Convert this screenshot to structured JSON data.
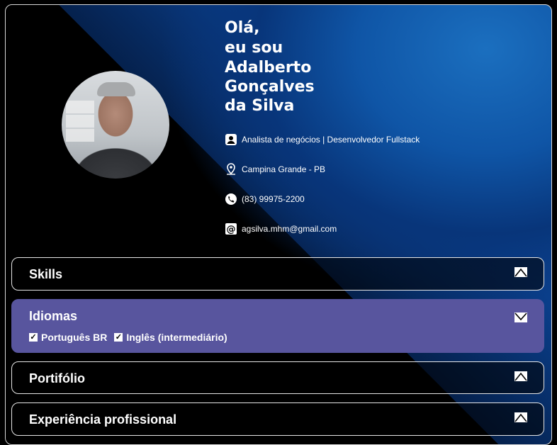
{
  "hero": {
    "greeting_line1": "Olá,",
    "greeting_line2": "eu sou",
    "name_line1": "Adalberto",
    "name_line2": "Gonçalves",
    "name_line3": "da Silva"
  },
  "contacts": [
    {
      "icon": "user-icon",
      "text": "Analista de negócios | Desenvolvedor Fullstack"
    },
    {
      "icon": "location-pin-icon",
      "text": "Campina Grande - PB"
    },
    {
      "icon": "phone-icon",
      "text": "(83) 99975-2200"
    },
    {
      "icon": "at-icon",
      "text": "agsilva.mhm@gmail.com"
    }
  ],
  "panels": {
    "skills": {
      "title": "Skills",
      "toggle_icon": "chevron-up-icon"
    },
    "idiomas": {
      "title": "Idiomas",
      "toggle_icon": "chevron-down-icon",
      "languages": [
        "Português BR",
        "Inglês (intermediário)"
      ]
    },
    "portfolio": {
      "title": "Portifólio",
      "toggle_icon": "chevron-up-icon"
    },
    "experience": {
      "title": "Experiência profissional",
      "toggle_icon": "chevron-up-icon"
    }
  },
  "colors": {
    "accent_blue": "#0f55a6",
    "idiomas_panel": "#58559e",
    "text": "#ffffff"
  }
}
